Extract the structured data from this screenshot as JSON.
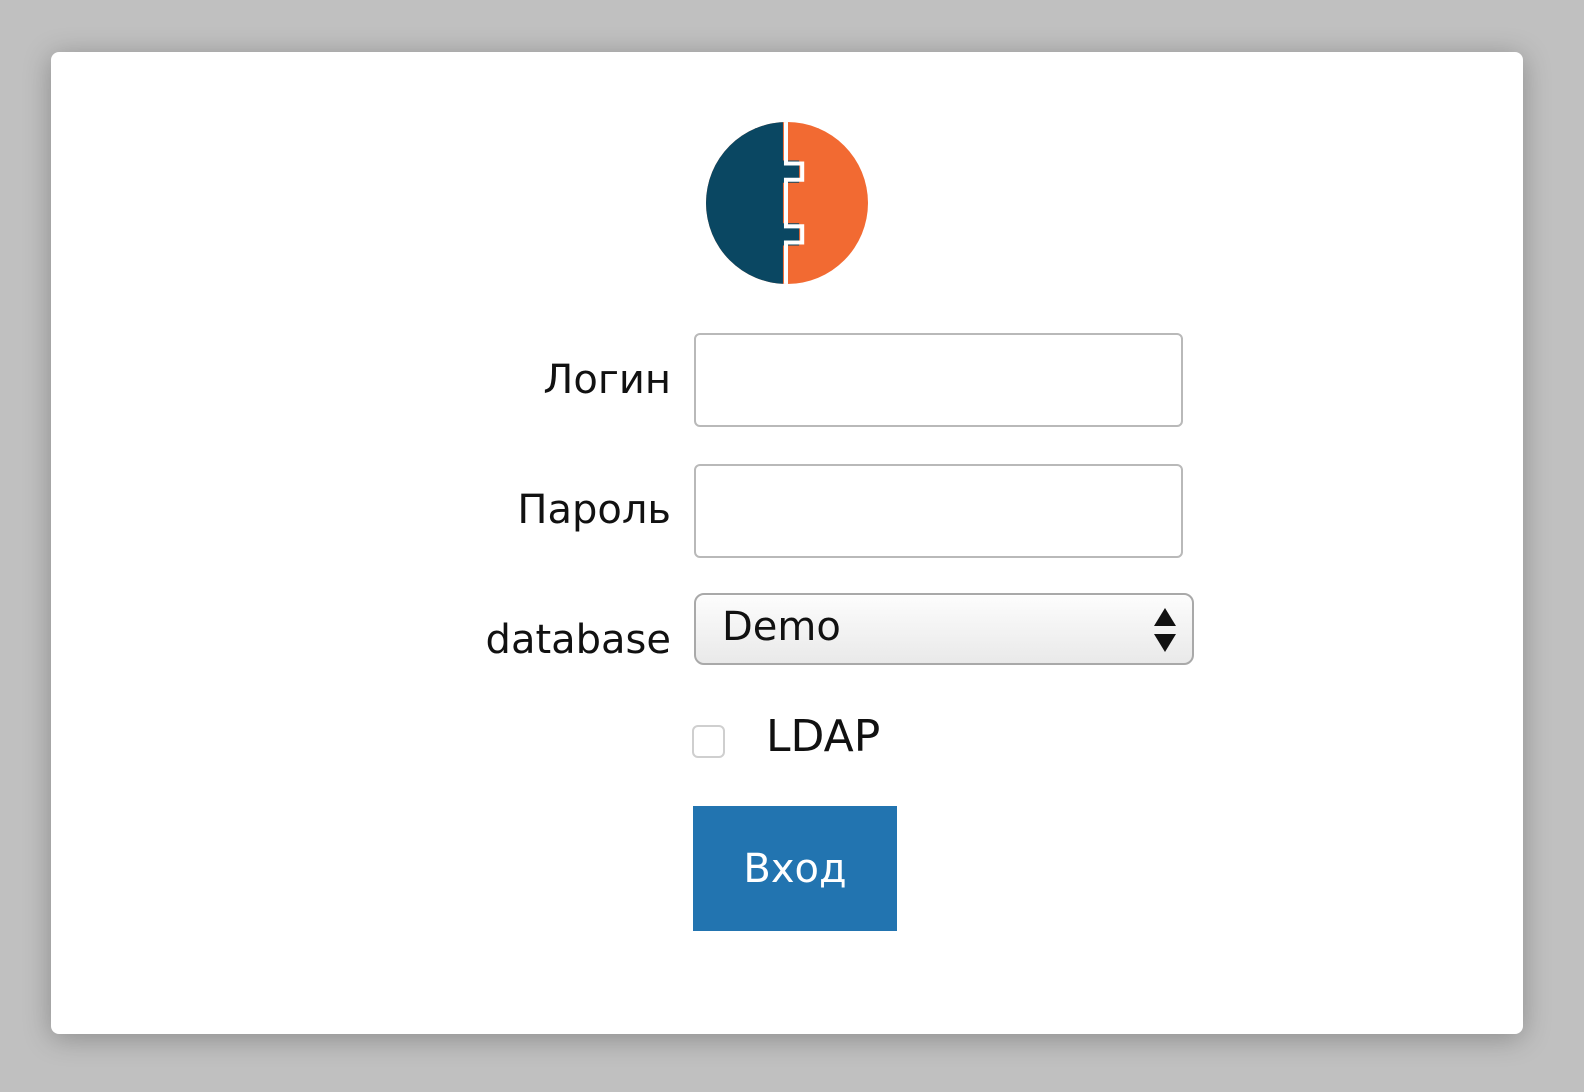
{
  "form": {
    "login_label": "Логин",
    "login_value": "",
    "password_label": "Пароль",
    "password_value": "",
    "database_label": "database",
    "database_selected": "Demo",
    "ldap_label": "LDAP",
    "ldap_checked": false,
    "submit_label": "Вход"
  },
  "colors": {
    "logo_left": "#0a4762",
    "logo_right": "#f26a32",
    "button_bg": "#2274b0",
    "page_bg": "#c0c0c0"
  },
  "icons": {
    "logo": "split-circle-logo",
    "select_arrows": "up-down-arrows-icon"
  }
}
